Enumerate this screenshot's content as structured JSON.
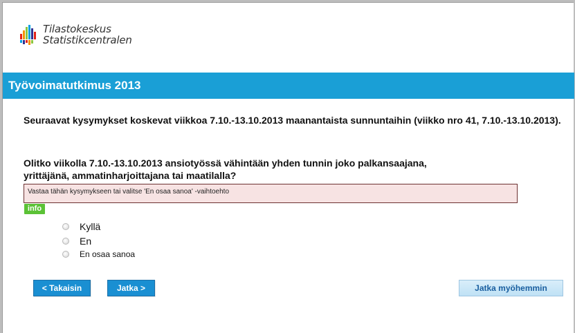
{
  "header": {
    "logo_line1": "Tilastokeskus",
    "logo_line2": "Statistikcentralen"
  },
  "titlebar": {
    "title": "Työvoimatutkimus 2013"
  },
  "intro": "Seuraavat kysymykset koskevat viikkoa 7.10.-13.10.2013 maanantaista sunnuntaihin (viikko nro 41, 7.10.-13.10.2013).",
  "question": "Olitko viikolla 7.10.-13.10.2013 ansiotyössä vähintään yhden tunnin joko palkansaajana, yrittäjänä, ammatinharjoittajana tai maatilalla?",
  "warning": "Vastaa tähän kysymykseen tai valitse 'En osaa sanoa' -vaihtoehto",
  "info_label": "info",
  "options": [
    {
      "label": "Kyllä"
    },
    {
      "label": "En"
    },
    {
      "label": "En osaa sanoa"
    }
  ],
  "buttons": {
    "back": "< Takaisin",
    "next": "Jatka >",
    "later": "Jatka myöhemmin"
  },
  "colors": {
    "titlebar": "#1a9fd6",
    "info_badge": "#5bc236",
    "warning_bg": "#f7e3e3",
    "button_blue": "#1a8fd2"
  }
}
